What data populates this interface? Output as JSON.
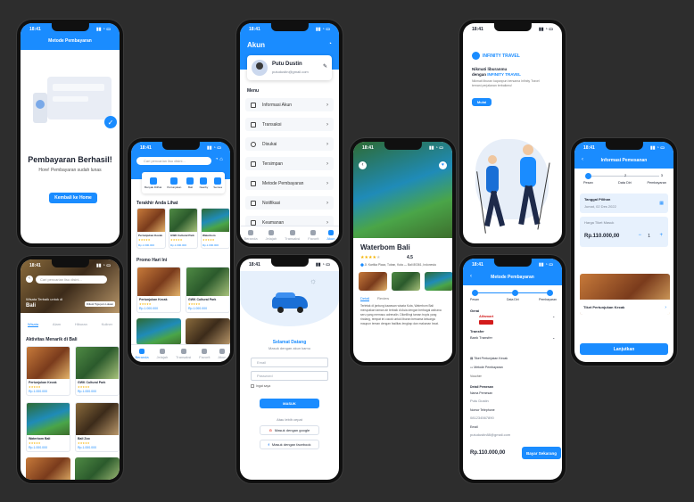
{
  "status_time": "18:41",
  "payment_success": {
    "title": "Metode Pembayaran",
    "heading": "Pembayaran Berhasil!",
    "sub": "Hore! Pembayaran sudah lunas",
    "button": "Kembali ke Home"
  },
  "home": {
    "search_placeholder": "Cari pencarian lisu disini...",
    "categories": [
      "Banyak Dilihat",
      "Pertunjukan",
      "Bali",
      "Nearby",
      "Semua"
    ],
    "recent_title": "Terakhir Anda Lihat",
    "recent": [
      {
        "name": "Pertunjukan Kecak",
        "price": "Rp.1.000.000"
      },
      {
        "name": "GWK Cultural Park",
        "price": "Rp.1.000.000"
      },
      {
        "name": "Waterbom",
        "price": "Rp.1.000.000"
      }
    ],
    "promo_title": "Promo Hari Ini",
    "promo": [
      {
        "name": "Pertunjukan Kecak",
        "price": "Rp.1.000.000"
      },
      {
        "name": "GWK Cultural Park",
        "price": "Rp.1.000.000"
      }
    ],
    "nav": [
      "Beranda",
      "Jelajah",
      "Transaksi",
      "Favorit",
      "Akun"
    ]
  },
  "explore": {
    "search_placeholder": "Cari pencarian lisu disini...",
    "subtitle": "Wisata Terbaik untuk di",
    "location": "Bali",
    "badge": "Diikuti Tiga jam Lokasi",
    "tabs": [
      "Wisata",
      "Alam",
      "Hiburan",
      "Kuliner"
    ],
    "section": "Aktivitas Menarik di Bali",
    "items": [
      {
        "name": "Pertunjukan Kecak",
        "price": "Rp.1.000.000"
      },
      {
        "name": "GWK Cultural Park",
        "price": "Rp.1.000.000"
      },
      {
        "name": "Waterbom Bali",
        "price": "Rp.1.000.000"
      },
      {
        "name": "Bali Zoo",
        "price": "Rp.1.000.000"
      }
    ]
  },
  "account": {
    "title": "Akun",
    "name": "Putu Dustin",
    "email": "putudustin@gmail.com",
    "menu_label": "Menu",
    "menu": [
      "Informasi Akun",
      "Transaksi",
      "Disukai",
      "Tersimpan",
      "Metode Pembayaran",
      "Notifikasi",
      "Keamanan"
    ],
    "nav": [
      "Beranda",
      "Jelajah",
      "Transaksi",
      "Favorit",
      "Akun"
    ]
  },
  "login": {
    "welcome": "Selamat Datang",
    "sub": "Masuk dengan akun kamu",
    "email_placeholder": "Email",
    "password_placeholder": "Password",
    "remember": "Ingat saya",
    "button": "MASUK",
    "or": "Atau lebih cepat",
    "google": "Masuk dengan google",
    "facebook": "Masuk dengan facebook"
  },
  "detail": {
    "title": "Waterbom Bali",
    "rating": "4.5",
    "address": "Jl. Kartika Plaza, Tuban, Kuta — Bali 80361, Indonesia",
    "tabs": [
      "Detail",
      "Review"
    ],
    "description": "Terletak di jantung kawasan wisata Kuta, Waterbom Bali merupakan taman air terbaik di Asia dengan berbagai wahana seru yang memacu adrenalin. Dikelilingi taman tropis yang rindang, tempat ini cocok untuk liburan bersama keluarga maupun teman dengan fasilitas lengkap dan makanan lezat."
  },
  "onboarding": {
    "brand": "INFINITY TRAVEL",
    "line1": "Nikmati liburanmu",
    "line2": "dengan",
    "line2_brand": "INFINITY TRAVEL",
    "desc": "Nikmati liburan kapanpun bersama Infinity Travel temani perjalanan terbaikmu!",
    "button": "Mulai"
  },
  "order_info": {
    "title": "Informasi Pemesanan",
    "steps": [
      "Pesan",
      "Data Diri",
      "Pembayaran"
    ],
    "date_label": "Tanggal Pilihan",
    "date_value": "Jumat, 02 Des 2022",
    "price_label": "Harga Tiket Masuk",
    "price": "Rp.110.000,00",
    "qty": "1",
    "minus": "−",
    "plus": "+",
    "ticket": "Tiket Pertunjukan Kecak",
    "button": "Lanjutkan"
  },
  "payment": {
    "title": "Metode Pembayaran",
    "steps": [
      "Pesan",
      "Data Diri",
      "Pembayaran"
    ],
    "gerai": "Gerai",
    "alfamart": "Alfamart",
    "transfer": "Transfer",
    "bank": "Bank Transfer",
    "ticket": "Tiket Pertunjukan Kecak",
    "method": "Metode Pembayaran",
    "voucher": "Voucher",
    "customer_section": "Detail Pemesan",
    "name_label": "Nama Pemesan",
    "name": "Putu Dustin",
    "phone_label": "Nomor Telephone",
    "phone": "081234567890",
    "email_label": "Email",
    "email": "putudustin88@gmail.com",
    "total": "Rp.110.000,00",
    "button": "Bayar Sekarang"
  }
}
